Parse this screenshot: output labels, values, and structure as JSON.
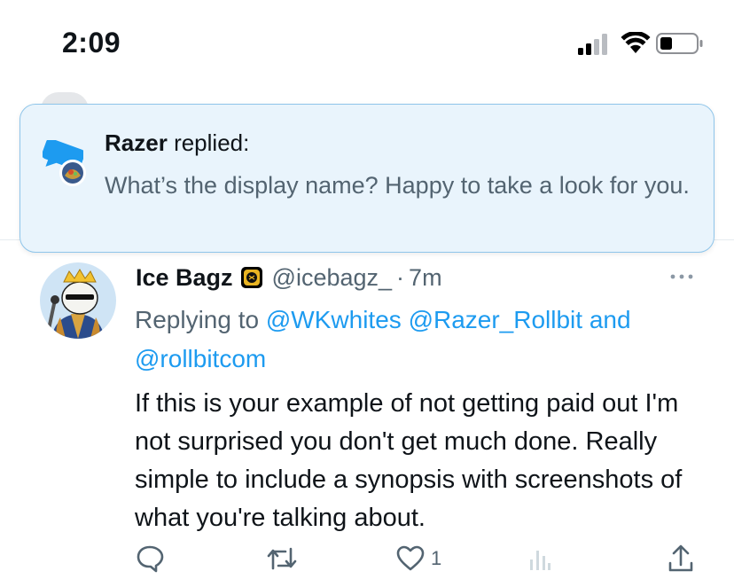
{
  "status_bar": {
    "time": "2:09",
    "icons": [
      "signal-icon",
      "wifi-icon",
      "battery-icon"
    ]
  },
  "notification": {
    "author": "Razer",
    "action": "replied:",
    "body": "What’s the display name? Happy to take a look for you.",
    "accent": "#1d9bf0",
    "background": "#e9f4fc"
  },
  "tweet": {
    "display_name": "Ice Bagz",
    "badge_icon": "gold-badge-icon",
    "handle": "@icebagz_",
    "separator": "·",
    "time": "7m",
    "replying_prefix": "Replying to",
    "mentions": [
      "@WKwhites",
      "@Razer_Rollbit",
      "@rollbitcom"
    ],
    "mention_joiner": "and",
    "text": "If this is your example of not getting paid out I'm not surprised you don't get much done. Really simple to include a synopsis with screenshots of what you're talking about.",
    "actions": {
      "reply_icon": "reply-icon",
      "retweet_icon": "retweet-icon",
      "like_icon": "like-icon",
      "like_count": "1",
      "views_icon": "views-icon",
      "share_icon": "share-icon"
    }
  },
  "colors": {
    "link": "#1d9bf0",
    "secondary_text": "#536471",
    "primary_text": "#0f1419"
  }
}
